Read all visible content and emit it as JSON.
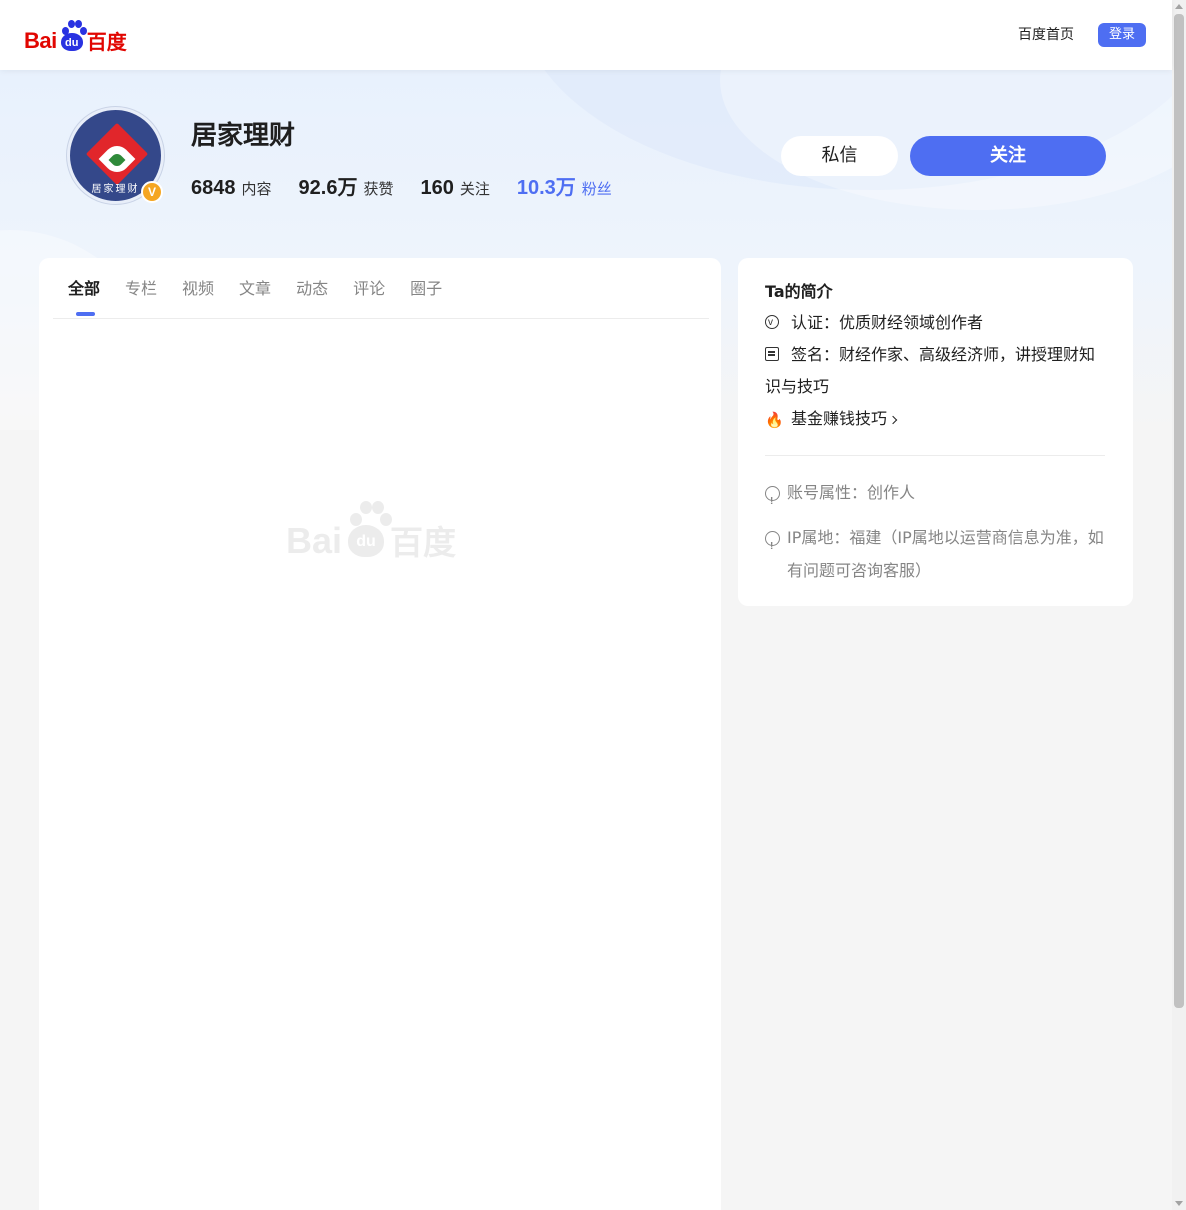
{
  "nav": {
    "logo_bai": "Bai",
    "logo_du": "du",
    "logo_cn": "百度",
    "home_link": "百度首页",
    "login_button": "登录"
  },
  "profile": {
    "name": "居家理财",
    "avatar_text": "居家理财",
    "verified_badge": "V",
    "stats": [
      {
        "value": "6848",
        "label": "内容"
      },
      {
        "value": "92.6万",
        "label": "获赞"
      },
      {
        "value": "160",
        "label": "关注"
      },
      {
        "value": "10.3万",
        "label": "粉丝"
      }
    ],
    "message_button": "私信",
    "follow_button": "关注",
    "accent_color": "#4e6ef2"
  },
  "tabs": [
    {
      "label": "全部",
      "active": true
    },
    {
      "label": "专栏",
      "active": false
    },
    {
      "label": "视频",
      "active": false
    },
    {
      "label": "文章",
      "active": false
    },
    {
      "label": "动态",
      "active": false
    },
    {
      "label": "评论",
      "active": false
    },
    {
      "label": "圈子",
      "active": false
    }
  ],
  "placeholder": {
    "bai": "Bai",
    "du": "du",
    "cn": "百度"
  },
  "intro": {
    "title": "Ta的简介",
    "certification": "认证：优质财经领域创作者",
    "signature": "签名：财经作家、高级经济师，讲授理财知识与技巧",
    "topic_link": "基金赚钱技巧",
    "account_type": "账号属性：创作人",
    "ip_location": "IP属地：福建（IP属地以运营商信息为准，如有问题可咨询客服）"
  }
}
